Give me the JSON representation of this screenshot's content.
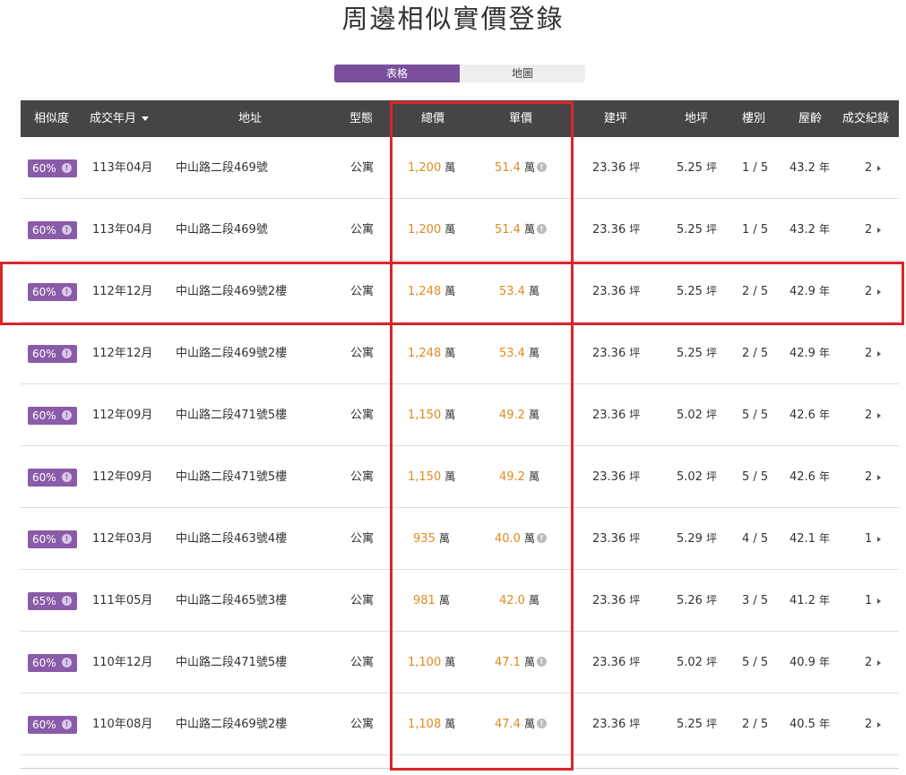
{
  "title": "周邊相似實價登錄",
  "view_toggle": {
    "table_label": "表格",
    "map_label": "地圖"
  },
  "columns": {
    "similarity": "相似度",
    "date": "成交年月",
    "address": "地址",
    "type": "型態",
    "total_price": "總價",
    "unit_price": "單價",
    "building_area": "建坪",
    "land_area": "地坪",
    "floor": "樓別",
    "age": "屋齡",
    "records": "成交紀錄"
  },
  "units": {
    "wan": "萬",
    "ping": "坪",
    "year": "年"
  },
  "rows": [
    {
      "similarity": "60%",
      "date": "113年04月",
      "address": "中山路二段469號",
      "type": "公寓",
      "total_price": "1,200",
      "unit_price": "51.4",
      "unit_price_info": true,
      "building_area": "23.36",
      "land_area": "5.25",
      "floor": "1 / 5",
      "age": "43.2",
      "records": "2"
    },
    {
      "similarity": "60%",
      "date": "113年04月",
      "address": "中山路二段469號",
      "type": "公寓",
      "total_price": "1,200",
      "unit_price": "51.4",
      "unit_price_info": true,
      "building_area": "23.36",
      "land_area": "5.25",
      "floor": "1 / 5",
      "age": "43.2",
      "records": "2"
    },
    {
      "similarity": "60%",
      "date": "112年12月",
      "address": "中山路二段469號2樓",
      "type": "公寓",
      "total_price": "1,248",
      "unit_price": "53.4",
      "unit_price_info": false,
      "building_area": "23.36",
      "land_area": "5.25",
      "floor": "2 / 5",
      "age": "42.9",
      "records": "2"
    },
    {
      "similarity": "60%",
      "date": "112年12月",
      "address": "中山路二段469號2樓",
      "type": "公寓",
      "total_price": "1,248",
      "unit_price": "53.4",
      "unit_price_info": false,
      "building_area": "23.36",
      "land_area": "5.25",
      "floor": "2 / 5",
      "age": "42.9",
      "records": "2"
    },
    {
      "similarity": "60%",
      "date": "112年09月",
      "address": "中山路二段471號5樓",
      "type": "公寓",
      "total_price": "1,150",
      "unit_price": "49.2",
      "unit_price_info": false,
      "building_area": "23.36",
      "land_area": "5.02",
      "floor": "5 / 5",
      "age": "42.6",
      "records": "2"
    },
    {
      "similarity": "60%",
      "date": "112年09月",
      "address": "中山路二段471號5樓",
      "type": "公寓",
      "total_price": "1,150",
      "unit_price": "49.2",
      "unit_price_info": false,
      "building_area": "23.36",
      "land_area": "5.02",
      "floor": "5 / 5",
      "age": "42.6",
      "records": "2"
    },
    {
      "similarity": "60%",
      "date": "112年03月",
      "address": "中山路二段463號4樓",
      "type": "公寓",
      "total_price": "935",
      "unit_price": "40.0",
      "unit_price_info": true,
      "building_area": "23.36",
      "land_area": "5.29",
      "floor": "4 / 5",
      "age": "42.1",
      "records": "1"
    },
    {
      "similarity": "65%",
      "date": "111年05月",
      "address": "中山路二段465號3樓",
      "type": "公寓",
      "total_price": "981",
      "unit_price": "42.0",
      "unit_price_info": false,
      "building_area": "23.36",
      "land_area": "5.26",
      "floor": "3 / 5",
      "age": "41.2",
      "records": "1"
    },
    {
      "similarity": "60%",
      "date": "110年12月",
      "address": "中山路二段471號5樓",
      "type": "公寓",
      "total_price": "1,100",
      "unit_price": "47.1",
      "unit_price_info": true,
      "building_area": "23.36",
      "land_area": "5.02",
      "floor": "5 / 5",
      "age": "40.9",
      "records": "2"
    },
    {
      "similarity": "60%",
      "date": "110年08月",
      "address": "中山路二段469號2樓",
      "type": "公寓",
      "total_price": "1,108",
      "unit_price": "47.4",
      "unit_price_info": true,
      "building_area": "23.36",
      "land_area": "5.25",
      "floor": "2 / 5",
      "age": "40.5",
      "records": "2"
    }
  ],
  "colors": {
    "header_bg": "#454545",
    "badge_bg": "#8a5ba8",
    "toggle_active": "#7a4f9e",
    "price": "#e08a1e",
    "highlight": "#d9262b"
  }
}
